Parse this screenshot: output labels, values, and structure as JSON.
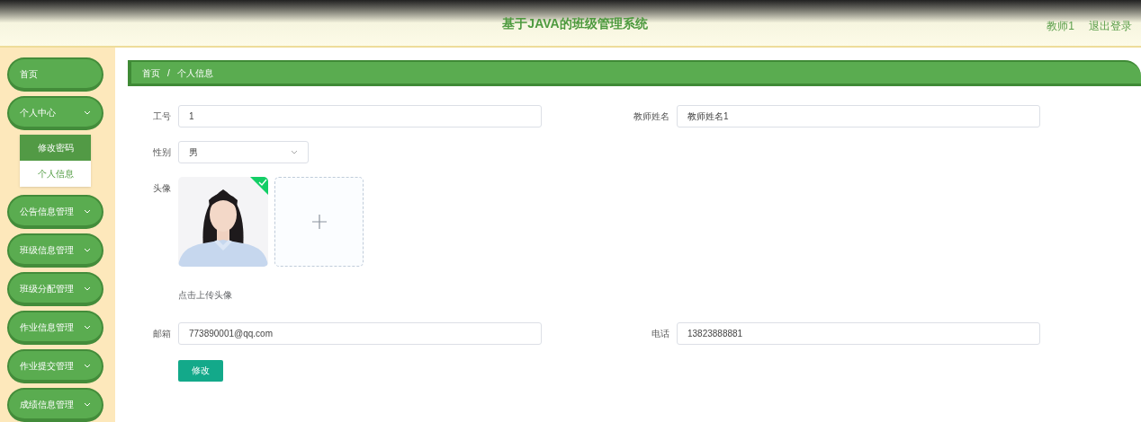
{
  "header": {
    "title": "基于JAVA的班级管理系统",
    "user": "教师1",
    "logout": "退出登录"
  },
  "sidebar": {
    "items": [
      {
        "label": "首页",
        "kind": "link"
      },
      {
        "label": "个人中心",
        "kind": "submenu",
        "expanded": true,
        "children": [
          {
            "label": "修改密码",
            "selected": true
          },
          {
            "label": "个人信息",
            "selected": false
          }
        ]
      },
      {
        "label": "公告信息管理",
        "kind": "submenu"
      },
      {
        "label": "班级信息管理",
        "kind": "submenu"
      },
      {
        "label": "班级分配管理",
        "kind": "submenu"
      },
      {
        "label": "作业信息管理",
        "kind": "submenu"
      },
      {
        "label": "作业提交管理",
        "kind": "submenu"
      },
      {
        "label": "成绩信息管理",
        "kind": "submenu"
      }
    ]
  },
  "breadcrumb": {
    "separator": "/",
    "items": [
      "首页",
      "个人信息"
    ]
  },
  "form": {
    "rows": [
      [
        {
          "label": "工号",
          "value": "1",
          "kind": "input"
        },
        {
          "label": "教师姓名",
          "value": "教师姓名1",
          "kind": "input"
        }
      ],
      [
        {
          "label": "性别",
          "value": "男",
          "kind": "select"
        }
      ],
      [
        {
          "label": "头像",
          "kind": "upload",
          "uploaded": true,
          "hint": "点击上传头像"
        }
      ],
      [
        {
          "label": "邮箱",
          "value": "773890001@qq.com",
          "kind": "input"
        },
        {
          "label": "电话",
          "value": "13823888881",
          "kind": "input"
        }
      ]
    ],
    "submit": "修改"
  }
}
